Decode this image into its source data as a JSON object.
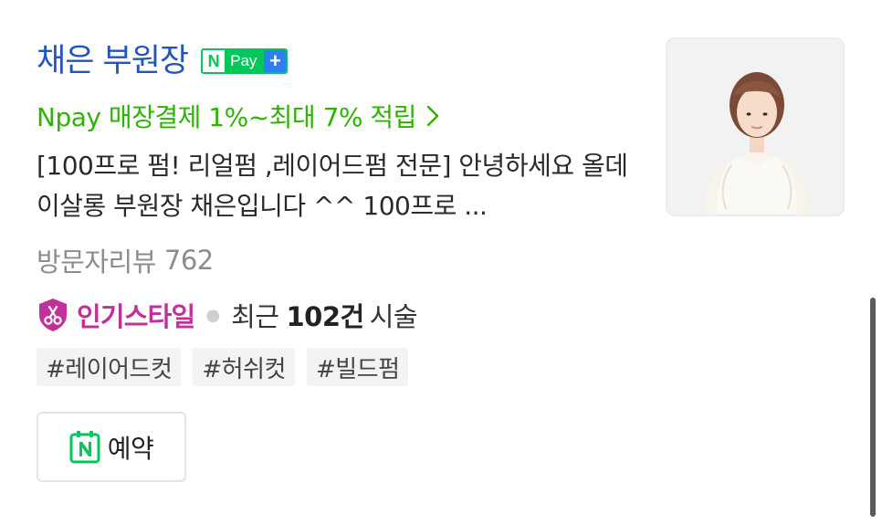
{
  "listing": {
    "title": "채은 부원장",
    "npay_badge": {
      "n_label": "N",
      "pay_label": "Pay",
      "plus_label": "+",
      "colors": {
        "green": "#03c75a",
        "blue": "#2c7ff0"
      }
    },
    "promo_text": "Npay 매장결제 1%~최대 7% 적립",
    "promo_chevron_icon": "chevron-right-icon",
    "description": "[100프로 펌! 리얼펌 ,레이어드펌 전문] 안녕하세요 올데이살롱 부원장 채은입니다 ^^ 100프로 ...",
    "reviews": {
      "label": "방문자리뷰",
      "count": "762"
    },
    "popular": {
      "icon": "scissors-shield-icon",
      "label": "인기스타일",
      "recent_label": "최근",
      "recent_count": "102건",
      "recent_unit": "시술"
    },
    "tags": [
      "#레이어드컷",
      "#허쉬컷",
      "#빌드펌"
    ],
    "reserve_button": {
      "icon": "naver-calendar-icon",
      "label": "예약"
    },
    "thumbnail": {
      "icon": "profile-photo"
    },
    "colors": {
      "title": "#2356b8",
      "promo": "#2db400",
      "popular": "#c0329a",
      "muted": "#8c8c8c"
    }
  }
}
